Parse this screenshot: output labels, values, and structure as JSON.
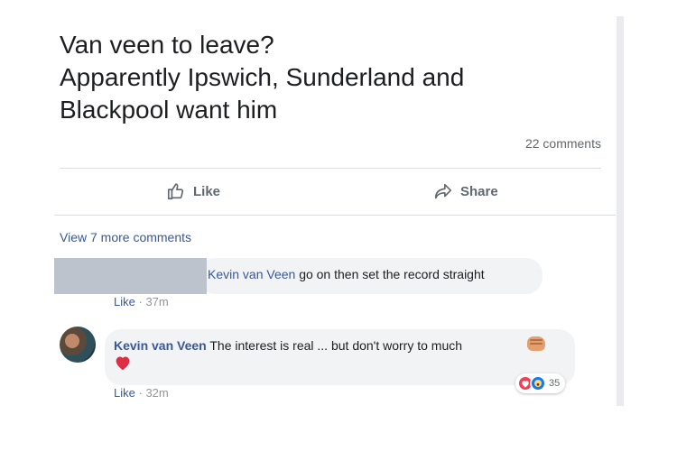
{
  "post": {
    "text_lines": [
      "Van veen to leave?",
      "Apparently Ipswich, Sunderland and",
      "Blackpool want him"
    ],
    "comments_count": "22 comments"
  },
  "actions": {
    "like_label": "Like",
    "share_label": "Share"
  },
  "comments_section": {
    "view_more_label": "View 7 more comments",
    "comments": [
      {
        "author": "Kevin van Veen",
        "text": "go on then set the record straight",
        "like_label": "Like",
        "separator": "·",
        "time": "37m"
      },
      {
        "author": "Kevin van Veen",
        "text": "The interest is real ... but don't worry to much",
        "like_label": "Like",
        "separator": "·",
        "time": "32m",
        "reaction_count": "35"
      }
    ]
  },
  "icons": {
    "like": "thumbs-up-icon",
    "share": "share-arrow-icon",
    "emoji_fist": "fist-bump-emoji",
    "emoji_heart": "red-heart-emoji",
    "reaction_love": "love-reaction-icon",
    "reaction_wow": "wow-reaction-icon"
  },
  "colors": {
    "link": "#385898",
    "text": "#1c1e21",
    "secondary": "#606770",
    "bubble": "#f2f3f5",
    "love": "#f33e58",
    "wow": "#1877f2"
  }
}
